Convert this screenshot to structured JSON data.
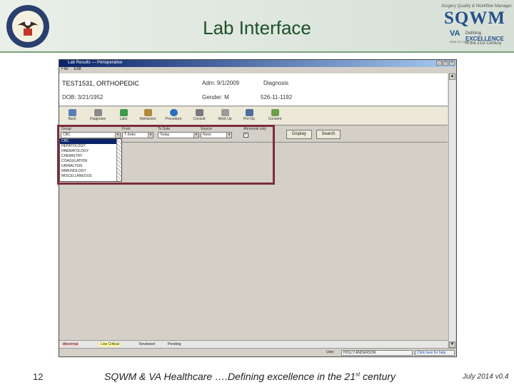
{
  "slide": {
    "title": "Lab Interface",
    "page_number": "12",
    "footer_main": "SQWM & VA Healthcare ….Defining excellence in the 21",
    "footer_sup": "st",
    "footer_end": " century",
    "date_version": "July 2014 v0.4"
  },
  "logos": {
    "sqwm_tagline": "Surgery Quality & Workflow Manager",
    "sqwm_word": "SQWM",
    "va_letters": "VA",
    "va_sub": "HEALTH CARE",
    "defining": "Defining",
    "excellence": "EXCELLENCE",
    "century": "in the 21st Century"
  },
  "app": {
    "window_title": "Lab Results — Perioperative",
    "menu": [
      "File",
      "Edit"
    ],
    "patient": {
      "name": "TEST1531, ORTHOPEDIC",
      "dob": "DOB: 3/21/1952",
      "admit": "Adm: 9/1/2009",
      "gender": "Gender: M",
      "diagnosis": "Diagnosis",
      "ssn": "526-11-1192"
    },
    "toolbar": [
      "Back",
      "Diagnosis",
      "Labs",
      "Admission",
      "Procedure",
      "Consult",
      "Work Up",
      "Pre-Op",
      "Consent"
    ],
    "filters": {
      "group_label": "Group",
      "group_value": "CBC",
      "from_label": "From",
      "from_value": "T-2wks",
      "to_label": "To Date",
      "to_value": "Today",
      "source_label": "Source",
      "source_value": "None",
      "abnormal_label": "Abnormal only",
      "abnormal_checked": "✓",
      "display_btn": "Display",
      "search_btn": "Search"
    },
    "group_options": [
      "CBC",
      "HEPATOLOGY",
      "HAEMATOLOGY",
      "CHEMISTRY",
      "COAGULATION",
      "URINALYSIS",
      "IMMUNOLOGY",
      "MISCELLANEOUS"
    ],
    "status_legend": [
      {
        "label": "Abnormal",
        "color": "#ffd0d0"
      },
      {
        "label": "Low Critical",
        "color": "#ffff99"
      },
      {
        "label": "Reviewed",
        "color": "#e6e6e6"
      },
      {
        "label": "Pending",
        "color": "#e6e6e6"
      }
    ],
    "footer": {
      "user_label": "User",
      "user_value": "HOLLY ANDERSON",
      "link_text": "Click here for help"
    }
  },
  "colors": {
    "highlight": "#7b2d3b",
    "title": "#1f4f2a",
    "sqwm_blue": "#24508a"
  }
}
